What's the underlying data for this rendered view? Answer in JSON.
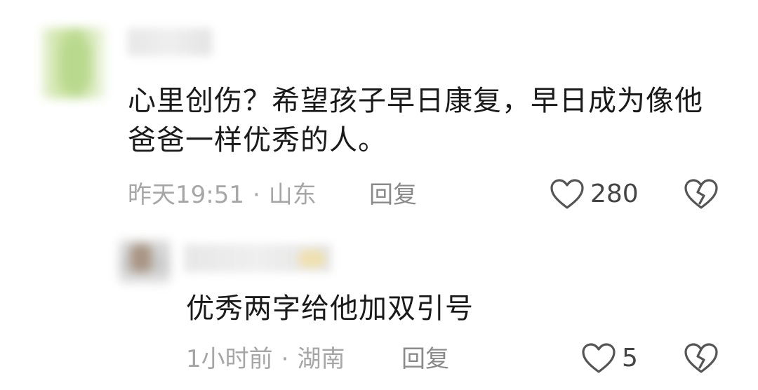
{
  "comments": [
    {
      "text": "心里创伤？希望孩子早日康复，早日成为像他爸爸一样优秀的人。",
      "time": "昨天19:51",
      "separator": "·",
      "location": "山东",
      "reply_label": "回复",
      "likes": "280",
      "like_icon": "heart-outline-icon",
      "dislike_icon": "broken-heart-icon"
    },
    {
      "text": "优秀两字给他加双引号",
      "time": "1小时前",
      "separator": "·",
      "location": "湖南",
      "reply_label": "回复",
      "likes": "5",
      "like_icon": "heart-outline-icon",
      "dislike_icon": "broken-heart-icon"
    }
  ],
  "colors": {
    "text": "#1a1a1a",
    "meta": "#a6a6a6",
    "icon": "#555555"
  }
}
